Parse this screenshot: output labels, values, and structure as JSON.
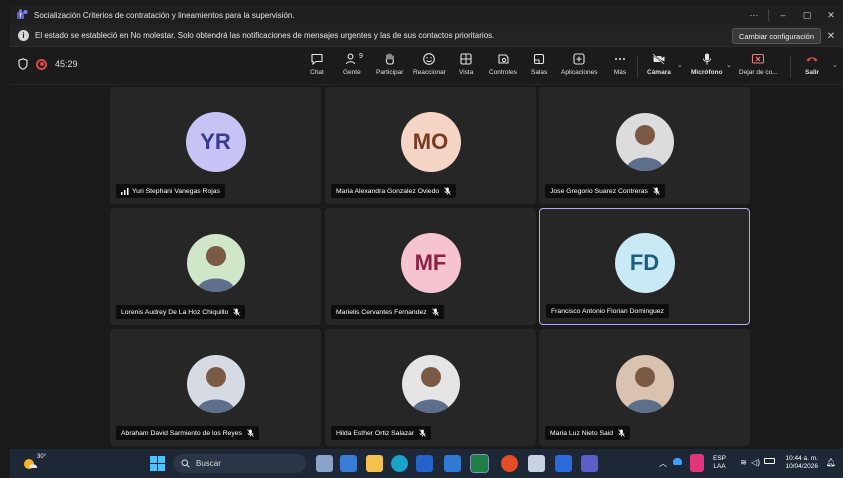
{
  "window": {
    "title": "Socialización Criterios de contratación y lineamientos para la supervisión.",
    "controls": [
      "···",
      "–",
      "▢",
      "✕"
    ]
  },
  "notification": {
    "message": "El estado se estableció en No molestar. Solo obtendrá las notificaciones de mensajes urgentes y las de sus contactos prioritarios.",
    "action_label": "Cambiar configuración",
    "close": "✕"
  },
  "toolbar": {
    "timer": "45:29",
    "items": [
      {
        "name": "chat",
        "label": "Chat"
      },
      {
        "name": "people",
        "label": "Gente",
        "badge": "9"
      },
      {
        "name": "raise-hand",
        "label": "Participar"
      },
      {
        "name": "react",
        "label": "Reaccionar"
      },
      {
        "name": "view",
        "label": "Vista"
      },
      {
        "name": "controls",
        "label": "Controles"
      },
      {
        "name": "rooms",
        "label": "Salas"
      },
      {
        "name": "apps",
        "label": "Aplicaciones"
      },
      {
        "name": "more",
        "label": "Más"
      }
    ],
    "camera_label": "Cámara",
    "mic_label": "Micrófono",
    "share_label": "Dejar de co...",
    "leave_label": "Salir"
  },
  "participants": [
    {
      "name": "Yuri Stephani Vanegas Rojas",
      "initials": "YR",
      "avatar_color": "#c7c3f5",
      "text_color": "#3b3a8f",
      "signal": true,
      "muted": false
    },
    {
      "name": "Maria Alexandra Gonzalez Oviedo",
      "initials": "MO",
      "avatar_color": "#f4d5c6",
      "text_color": "#7a3b23",
      "signal": false,
      "muted": true
    },
    {
      "name": "Jose Gregorio Suarez Contreras",
      "initials": "",
      "avatar_color": "#dcdcdc",
      "text_color": "#333",
      "signal": false,
      "muted": true
    },
    {
      "name": "Lorenis Audrey De La Hoz Chiquillo",
      "initials": "",
      "avatar_color": "#cfe6c9",
      "text_color": "#333",
      "signal": false,
      "muted": true
    },
    {
      "name": "Marielis Cervantes Fernandez",
      "initials": "MF",
      "avatar_color": "#f6c3d0",
      "text_color": "#8a2445",
      "signal": false,
      "muted": true
    },
    {
      "name": "Francisco Antonio Florian Dominguez",
      "initials": "FD",
      "avatar_color": "#c9e9f4",
      "text_color": "#1b5e79",
      "signal": false,
      "muted": false
    },
    {
      "name": "Abraham David Sarmiento de los Reyes",
      "initials": "",
      "avatar_color": "#d6dbe3",
      "text_color": "#333",
      "signal": false,
      "muted": true
    },
    {
      "name": "Hilda Esther Ortiz Salazar",
      "initials": "",
      "avatar_color": "#e5e5e5",
      "text_color": "#333",
      "signal": false,
      "muted": true
    },
    {
      "name": "Maria Luz Nieto Said",
      "initials": "",
      "avatar_color": "#d9c2b0",
      "text_color": "#333",
      "signal": false,
      "muted": true
    }
  ],
  "taskbar": {
    "weather_temp": "30°",
    "search_label": "Buscar",
    "lang_line1": "ESP",
    "lang_line2": "LAA",
    "time": "10:44 a. m.",
    "date": "10/04/2026"
  },
  "colors": {
    "accent_purple": "#a8a8ff",
    "leave_red": "#e04848",
    "taskbar": "#1d2736"
  }
}
